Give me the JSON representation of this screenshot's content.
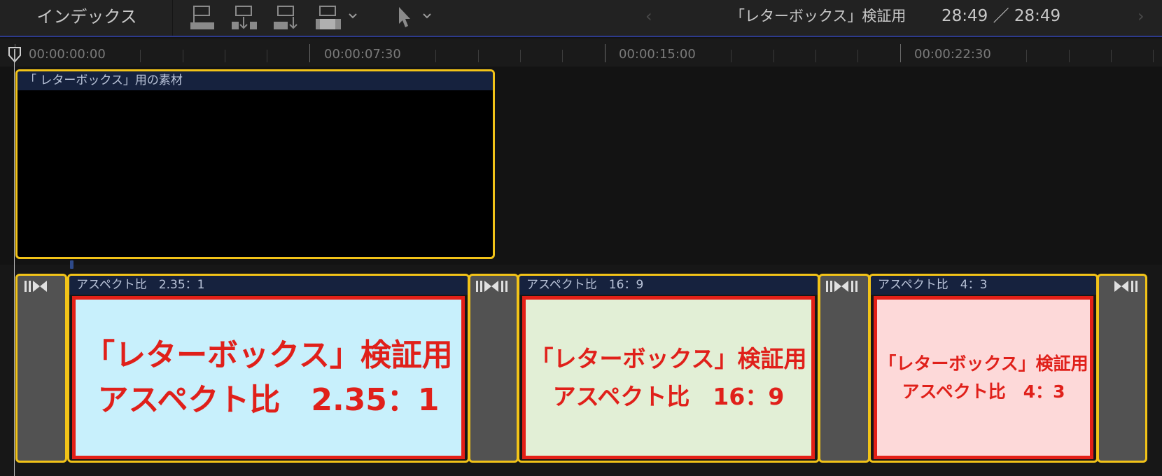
{
  "toolbar": {
    "index_label": "インデックス",
    "project_title": "「レターボックス」検証用",
    "timecode": "28:49 ／ 28:49",
    "prev_arrow": "‹",
    "next_arrow": "›"
  },
  "ruler": {
    "labels": [
      "00:00:00:00",
      "00:00:07:30",
      "00:00:15:00",
      "00:00:22:30"
    ]
  },
  "connected_clip": {
    "label": "「 レターボックス」用の素材"
  },
  "clips": [
    {
      "label": "アスペクト比　2.35：1",
      "line1": "「レターボックス」検証用",
      "line2": "アスペクト比　2.35：1",
      "bg": "#c8f0fc"
    },
    {
      "label": "アスペクト比　16：9",
      "line1": "「レターボックス」検証用",
      "line2": "アスペクト比　16：9",
      "bg": "#e2efd6"
    },
    {
      "label": "アスペクト比　4：3",
      "line1": "「レターボックス」検証用",
      "line2": "アスペクト比　4：3",
      "bg": "#fdd9d9"
    }
  ],
  "colors": {
    "selection": "#f2c318",
    "thumb_text": "#e0201a",
    "clip_header": "#16223e"
  }
}
